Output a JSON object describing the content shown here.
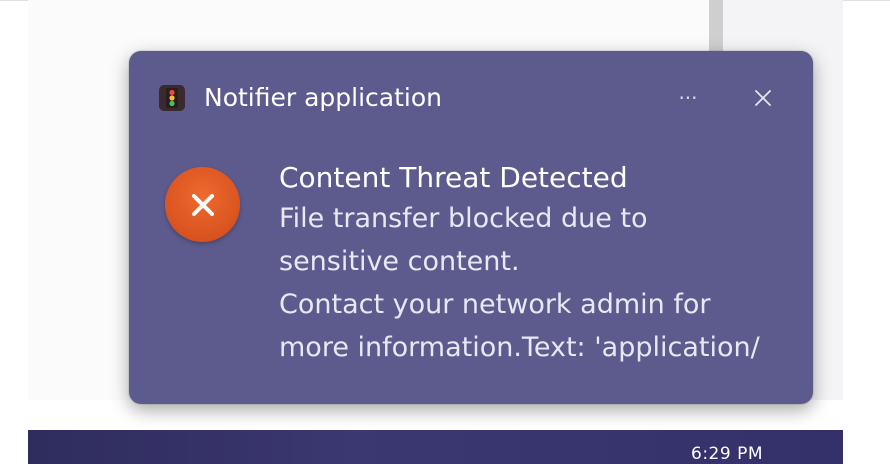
{
  "toast": {
    "app_name": "Notifier application",
    "app_icon": "traffic-light-icon",
    "more_label": "···",
    "close_icon": "close-icon",
    "status_icon": "error-x-icon",
    "heading": "Content Threat Detected",
    "lines": [
      "File transfer blocked due to",
      "sensitive content.",
      "Contact your network admin for",
      "more information.Text: 'application/"
    ]
  },
  "taskbar": {
    "time": "6:29 PM"
  },
  "colors": {
    "toast_background": "#5d5b8d",
    "error_accent": "#e0571f",
    "taskbar": "#34306a"
  }
}
